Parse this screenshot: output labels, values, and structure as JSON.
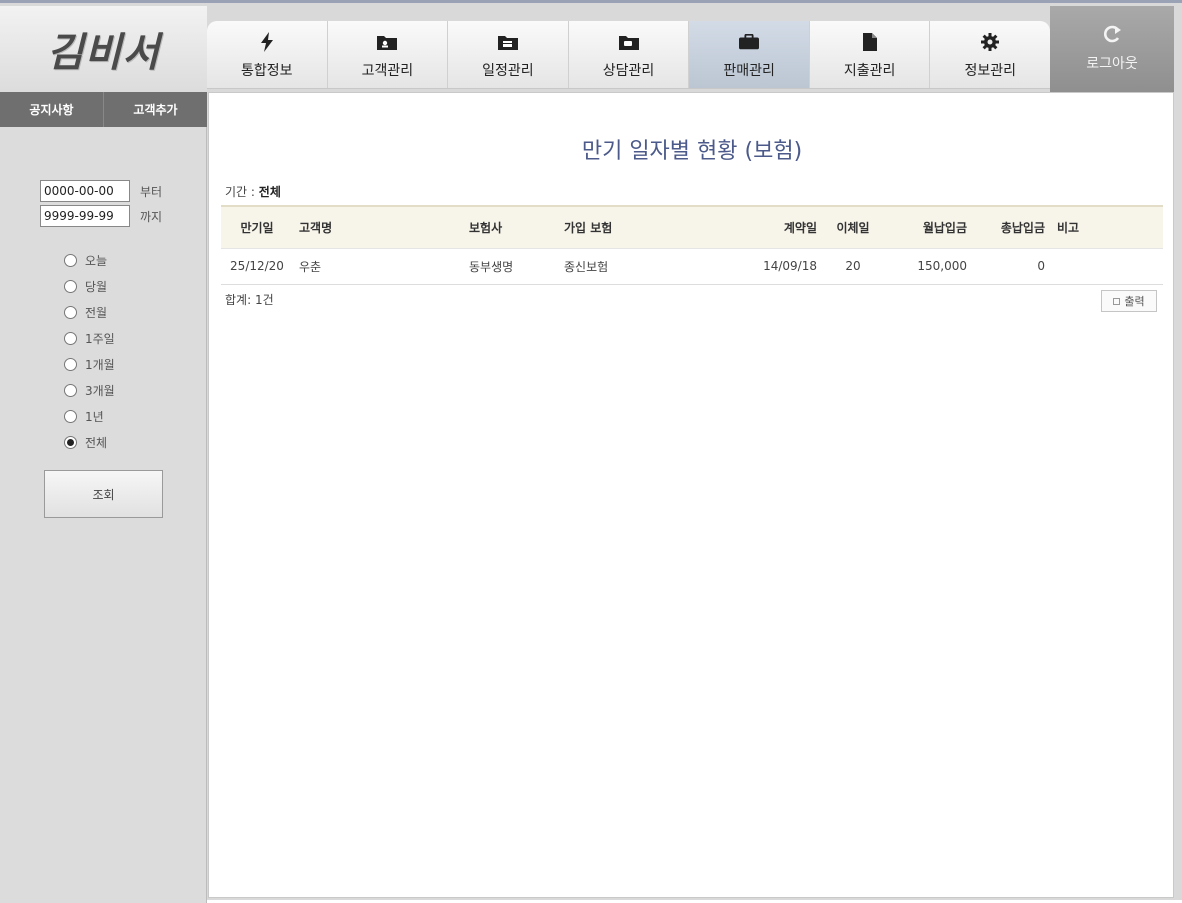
{
  "brand": {
    "logo_text": "김비서"
  },
  "top_nav": [
    {
      "label": "통합정보",
      "icon": "lightning-icon",
      "active": false
    },
    {
      "label": "고객관리",
      "icon": "customer-folder-icon",
      "active": false
    },
    {
      "label": "일정관리",
      "icon": "schedule-folder-icon",
      "active": false
    },
    {
      "label": "상담관리",
      "icon": "consult-folder-icon",
      "active": false
    },
    {
      "label": "판매관리",
      "icon": "briefcase-icon",
      "active": true
    },
    {
      "label": "지출관리",
      "icon": "document-icon",
      "active": false
    },
    {
      "label": "정보관리",
      "icon": "gear-icon",
      "active": false
    }
  ],
  "logout": {
    "label": "로그아웃",
    "icon": "logout-arrow-icon"
  },
  "sub_nav": [
    {
      "label": "공지사항"
    },
    {
      "label": "고객추가"
    }
  ],
  "filter": {
    "from_value": "0000-00-00",
    "from_suffix": "부터",
    "to_value": "9999-99-99",
    "to_suffix": "까지",
    "ranges": [
      {
        "label": "오늘",
        "selected": false
      },
      {
        "label": "당월",
        "selected": false
      },
      {
        "label": "전월",
        "selected": false
      },
      {
        "label": "1주일",
        "selected": false
      },
      {
        "label": "1개월",
        "selected": false
      },
      {
        "label": "3개월",
        "selected": false
      },
      {
        "label": "1년",
        "selected": false
      },
      {
        "label": "전체",
        "selected": true
      }
    ],
    "search_label": "조회"
  },
  "main": {
    "title": "만기 일자별 현황 (보험)",
    "period_label": "기간 :",
    "period_value": "전체",
    "columns": [
      "만기일",
      "고객명",
      "보험사",
      "가입 보험",
      "계약일",
      "이체일",
      "월납입금",
      "총납입금",
      "비고"
    ],
    "rows": [
      [
        "25/12/20",
        "우춘",
        "동부생명",
        "종신보험",
        "14/09/18",
        "20",
        "150,000",
        "0",
        ""
      ]
    ],
    "total_label": "합계: 1건",
    "print_label": "출력"
  }
}
